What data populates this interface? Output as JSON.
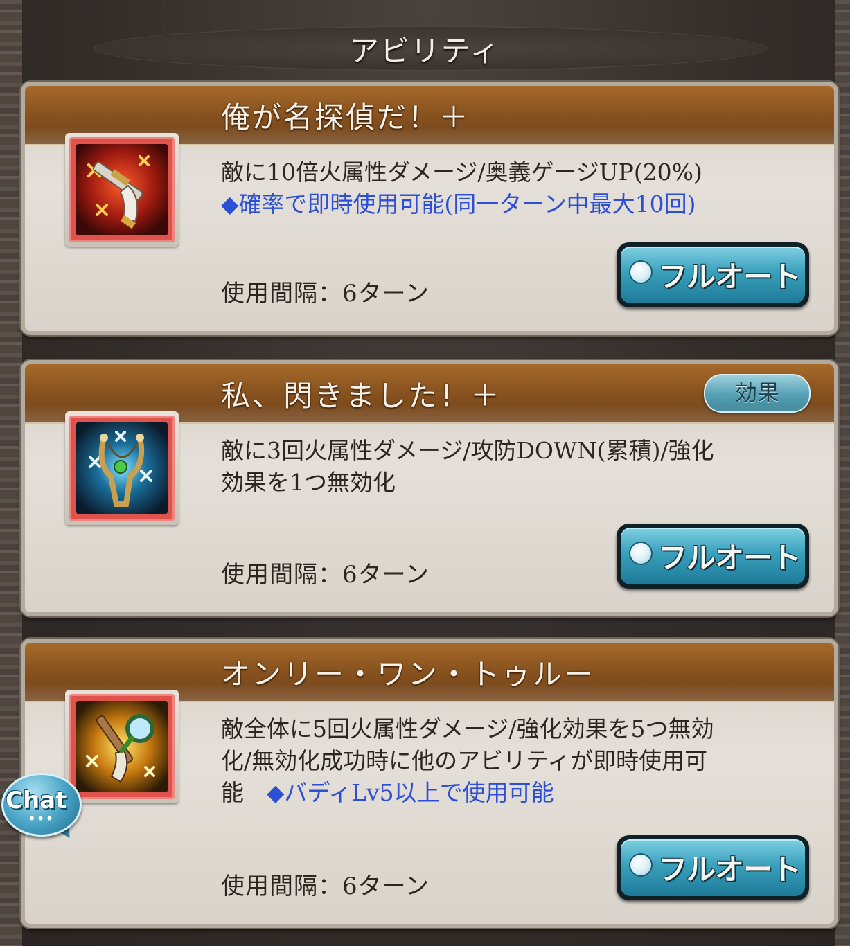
{
  "page": {
    "title": "アビリティ"
  },
  "abilities": [
    {
      "name": "俺が名探偵だ！＋",
      "icon": "flintlock-pistol-icon",
      "desc_line1": "敵に10倍火属性ダメージ/奥義ゲージUP(20%)",
      "desc_blue": "◆確率で即時使用可能(同一ターン中最大10回)",
      "interval": "使用間隔：6ターン",
      "auto_label": "フルオート"
    },
    {
      "name": "私、閃きました！＋",
      "effect_label": "効果",
      "icon": "slingshot-icon",
      "desc_line1": "敵に3回火属性ダメージ/攻防DOWN(累積)/強化",
      "desc_line2": "効果を1つ無効化",
      "interval": "使用間隔：6ターン",
      "auto_label": "フルオート"
    },
    {
      "name": "オンリー・ワン・トゥルー",
      "icon": "pistol-magnifier-icon",
      "desc_line1": "敵全体に5回火属性ダメージ/強化効果を5つ無効",
      "desc_line2": "化/無効化成功時に他のアビリティが即時使用可",
      "desc_line3_plain": "能　",
      "desc_blue": "◆バディLv5以上で使用可能",
      "interval": "使用間隔：6ターン",
      "auto_label": "フルオート"
    }
  ],
  "chat": {
    "label": "Chat",
    "dots": "•••"
  },
  "colors": {
    "header_brown": "#8a5420",
    "desc_blue": "#2c4fd6",
    "button_teal": "#3aa0bc",
    "icon_frame_red": "#e0524c"
  }
}
